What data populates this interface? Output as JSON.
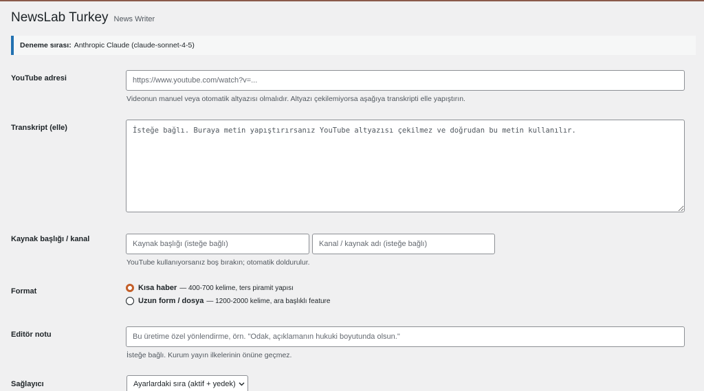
{
  "header": {
    "title": "NewsLab Turkey",
    "subtitle": "News Writer"
  },
  "notice": {
    "label": "Deneme sırası:",
    "value": "Anthropic Claude (claude-sonnet-4-5)"
  },
  "youtube": {
    "label": "YouTube adresi",
    "placeholder": "https://www.youtube.com/watch?v=...",
    "description": "Videonun manuel veya otomatik altyazısı olmalıdır. Altyazı çekilemiyorsa aşağıya transkripti elle yapıştırın."
  },
  "transcript": {
    "label": "Transkript (elle)",
    "placeholder": "İsteğe bağlı. Buraya metin yapıştırırsanız YouTube altyazısı çekilmez ve doğrudan bu metin kullanılır."
  },
  "source": {
    "label": "Kaynak başlığı / kanal",
    "title_placeholder": "Kaynak başlığı (isteğe bağlı)",
    "channel_placeholder": "Kanal / kaynak adı (isteğe bağlı)",
    "description": "YouTube kullanıyorsanız boş bırakın; otomatik doldurulur."
  },
  "format": {
    "label": "Format",
    "options": [
      {
        "title": "Kısa haber",
        "desc": "— 400-700 kelime, ters piramit yapısı",
        "checked": true
      },
      {
        "title": "Uzun form / dosya",
        "desc": "— 1200-2000 kelime, ara başlıklı feature",
        "checked": false
      }
    ]
  },
  "editor_note": {
    "label": "Editör notu",
    "placeholder": "Bu üretime özel yönlendirme, örn. \"Odak, açıklamanın hukuki boyutunda olsun.\"",
    "description": "İsteğe bağlı. Kurum yayın ilkelerinin önüne geçmez."
  },
  "provider": {
    "label": "Sağlayıcı",
    "selected": "Ayarlardaki sıra (aktif + yedek)",
    "chevron_icon": "chevron-down-icon"
  },
  "colors": {
    "accent": "#2271b1",
    "radio_checked": "#c35e28",
    "background": "#f0f0f1"
  }
}
